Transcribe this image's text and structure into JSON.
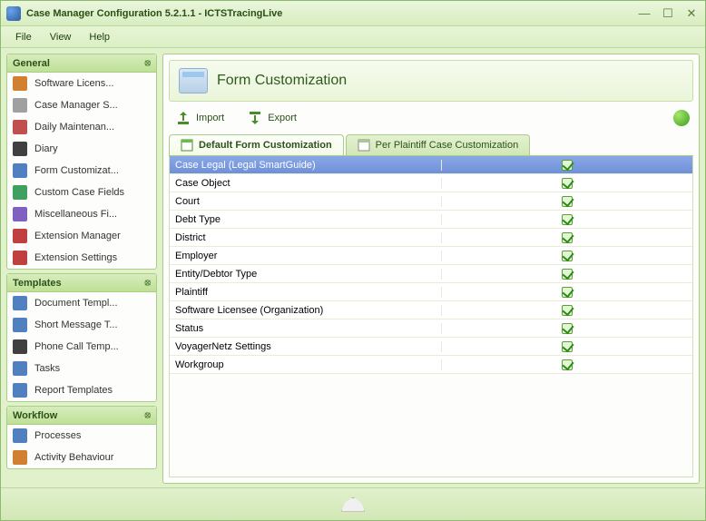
{
  "window": {
    "title": "Case Manager Configuration 5.2.1.1 - ICTSTracingLive"
  },
  "menu": {
    "file": "File",
    "view": "View",
    "help": "Help"
  },
  "sidebar": {
    "general": {
      "title": "General",
      "items": [
        "Software Licens...",
        "Case Manager S...",
        "Daily Maintenan...",
        "Diary",
        "Form Customizat...",
        "Custom Case Fields",
        "Miscellaneous Fi...",
        "Extension Manager",
        "Extension Settings"
      ]
    },
    "templates": {
      "title": "Templates",
      "items": [
        "Document Templ...",
        "Short Message T...",
        "Phone Call Temp...",
        "Tasks",
        "Report Templates"
      ]
    },
    "workflow": {
      "title": "Workflow",
      "items": [
        "Processes",
        "Activity Behaviour"
      ]
    }
  },
  "main": {
    "heading": "Form Customization",
    "toolbar": {
      "import": "Import",
      "export": "Export"
    },
    "tabs": {
      "default": "Default Form Customization",
      "per_plaintiff": "Per Plaintiff Case Customization"
    },
    "grid": [
      {
        "name": "Case Legal (Legal SmartGuide)",
        "checked": true,
        "selected": true
      },
      {
        "name": "Case Object",
        "checked": true
      },
      {
        "name": "Court",
        "checked": true
      },
      {
        "name": "Debt Type",
        "checked": true
      },
      {
        "name": "District",
        "checked": true
      },
      {
        "name": "Employer",
        "checked": true
      },
      {
        "name": "Entity/Debtor Type",
        "checked": true
      },
      {
        "name": "Plaintiff",
        "checked": true
      },
      {
        "name": "Software Licensee (Organization)",
        "checked": true
      },
      {
        "name": "Status",
        "checked": true
      },
      {
        "name": "VoyagerNetz Settings",
        "checked": true
      },
      {
        "name": "Workgroup",
        "checked": true
      }
    ]
  }
}
